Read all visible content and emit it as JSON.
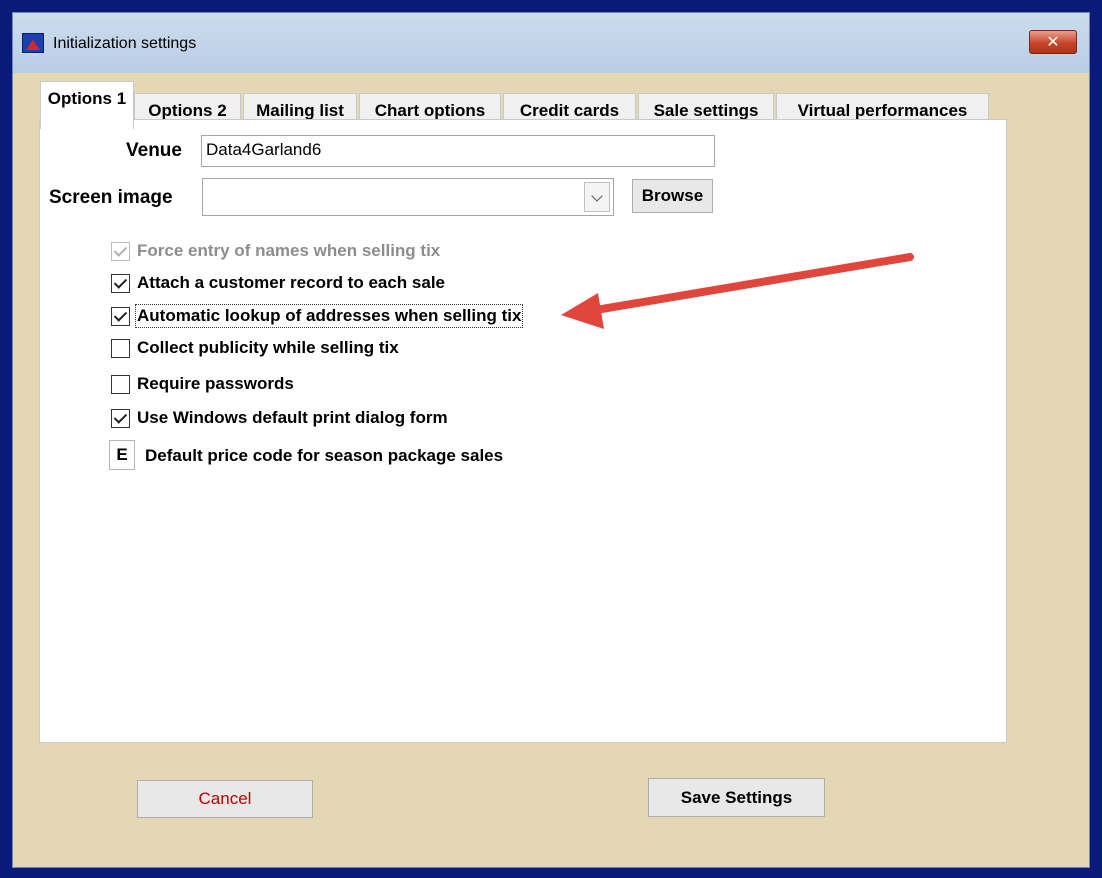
{
  "window": {
    "title": "Initialization settings",
    "close_label": "✕",
    "app_icon": "theater-app-icon"
  },
  "tabs": [
    {
      "label": "Options 1",
      "active": true
    },
    {
      "label": "Options 2",
      "active": false
    },
    {
      "label": "Mailing list",
      "active": false
    },
    {
      "label": "Chart options",
      "active": false
    },
    {
      "label": "Credit cards",
      "active": false
    },
    {
      "label": "Sale settings",
      "active": false
    },
    {
      "label": "Virtual performances",
      "active": false
    }
  ],
  "form": {
    "venue_label": "Venue",
    "venue_value": "Data4Garland6",
    "screen_image_label": "Screen image",
    "screen_image_value": "",
    "browse_label": "Browse"
  },
  "checkboxes": [
    {
      "label": "Force entry of names when selling tix",
      "checked": true,
      "disabled": true
    },
    {
      "label": "Attach a customer record to each sale",
      "checked": true,
      "disabled": false
    },
    {
      "label": "Automatic lookup of addresses when selling tix",
      "checked": true,
      "disabled": false,
      "focused": true
    },
    {
      "label": "Collect publicity while selling tix",
      "checked": false,
      "disabled": false
    },
    {
      "label": "Require passwords",
      "checked": false,
      "disabled": false
    },
    {
      "label": "Use Windows default print dialog form",
      "checked": true,
      "disabled": false
    }
  ],
  "price_code": {
    "value": "E",
    "label": "Default price code for season package sales"
  },
  "buttons": {
    "cancel": "Cancel",
    "save": "Save Settings"
  },
  "colors": {
    "annotation_arrow": "#e0463c",
    "cancel_text": "#c00000"
  }
}
